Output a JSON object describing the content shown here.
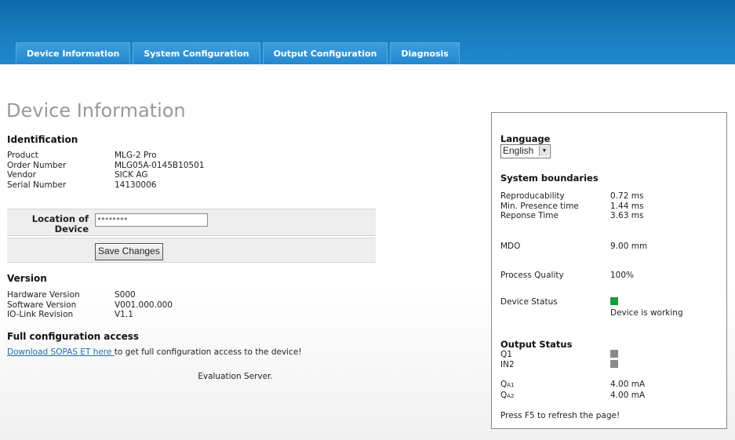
{
  "tabs": [
    "Device Information",
    "System Configuration",
    "Output Configuration",
    "Diagnosis"
  ],
  "page_title": "Device Information",
  "identification": {
    "heading": "Identification",
    "rows": [
      {
        "key": "Product",
        "value": "MLG-2 Pro"
      },
      {
        "key": "Order Number",
        "value": "MLG05A-0145B10501"
      },
      {
        "key": "Vendor",
        "value": "SICK AG"
      },
      {
        "key": "Serial Number",
        "value": "14130006"
      }
    ]
  },
  "location": {
    "label_line1": "Location of",
    "label_line2": "Device",
    "value": "********"
  },
  "save_button": "Save Changes",
  "version": {
    "heading": "Version",
    "rows": [
      {
        "key": "Hardware Version",
        "value": "S000"
      },
      {
        "key": "Software Version",
        "value": "V001.000.000"
      },
      {
        "key": "IO-Link Revision",
        "value": "V1.1"
      }
    ]
  },
  "full_access": {
    "heading": "Full configuration access",
    "link": "Download SOPAS ET here ",
    "text": "to get full configuration access to the device!"
  },
  "evaluation": "Evaluation Server.",
  "panel": {
    "language_heading": "Language",
    "language_value": "English",
    "boundaries_heading": "System boundaries",
    "boundaries": [
      {
        "key": "Reproducability",
        "value": "0.72 ms"
      },
      {
        "key": "Min. Presence time",
        "value": "1.44 ms"
      },
      {
        "key": "Reponse Time",
        "value": "3.63 ms"
      }
    ],
    "mdo_key": "MDO",
    "mdo_value": "9.00 mm",
    "quality_key": "Process Quality",
    "quality_value": "100%",
    "device_status_key": "Device Status",
    "device_status_value": "Device is working",
    "output_heading": "Output Status",
    "outputs": [
      "Q1",
      "IN2"
    ],
    "analog": [
      {
        "base": "Q",
        "sub": "A1",
        "value": "4.00 mA"
      },
      {
        "base": "Q",
        "sub": "A2",
        "value": "4.00 mA"
      }
    ],
    "refresh": "Press F5 to refresh the page!"
  },
  "colors": {
    "topbar": "#1a7fc2",
    "tab": "#2488cf",
    "status_ok": "#1a9a3a",
    "status_off": "#8a8a8a"
  }
}
